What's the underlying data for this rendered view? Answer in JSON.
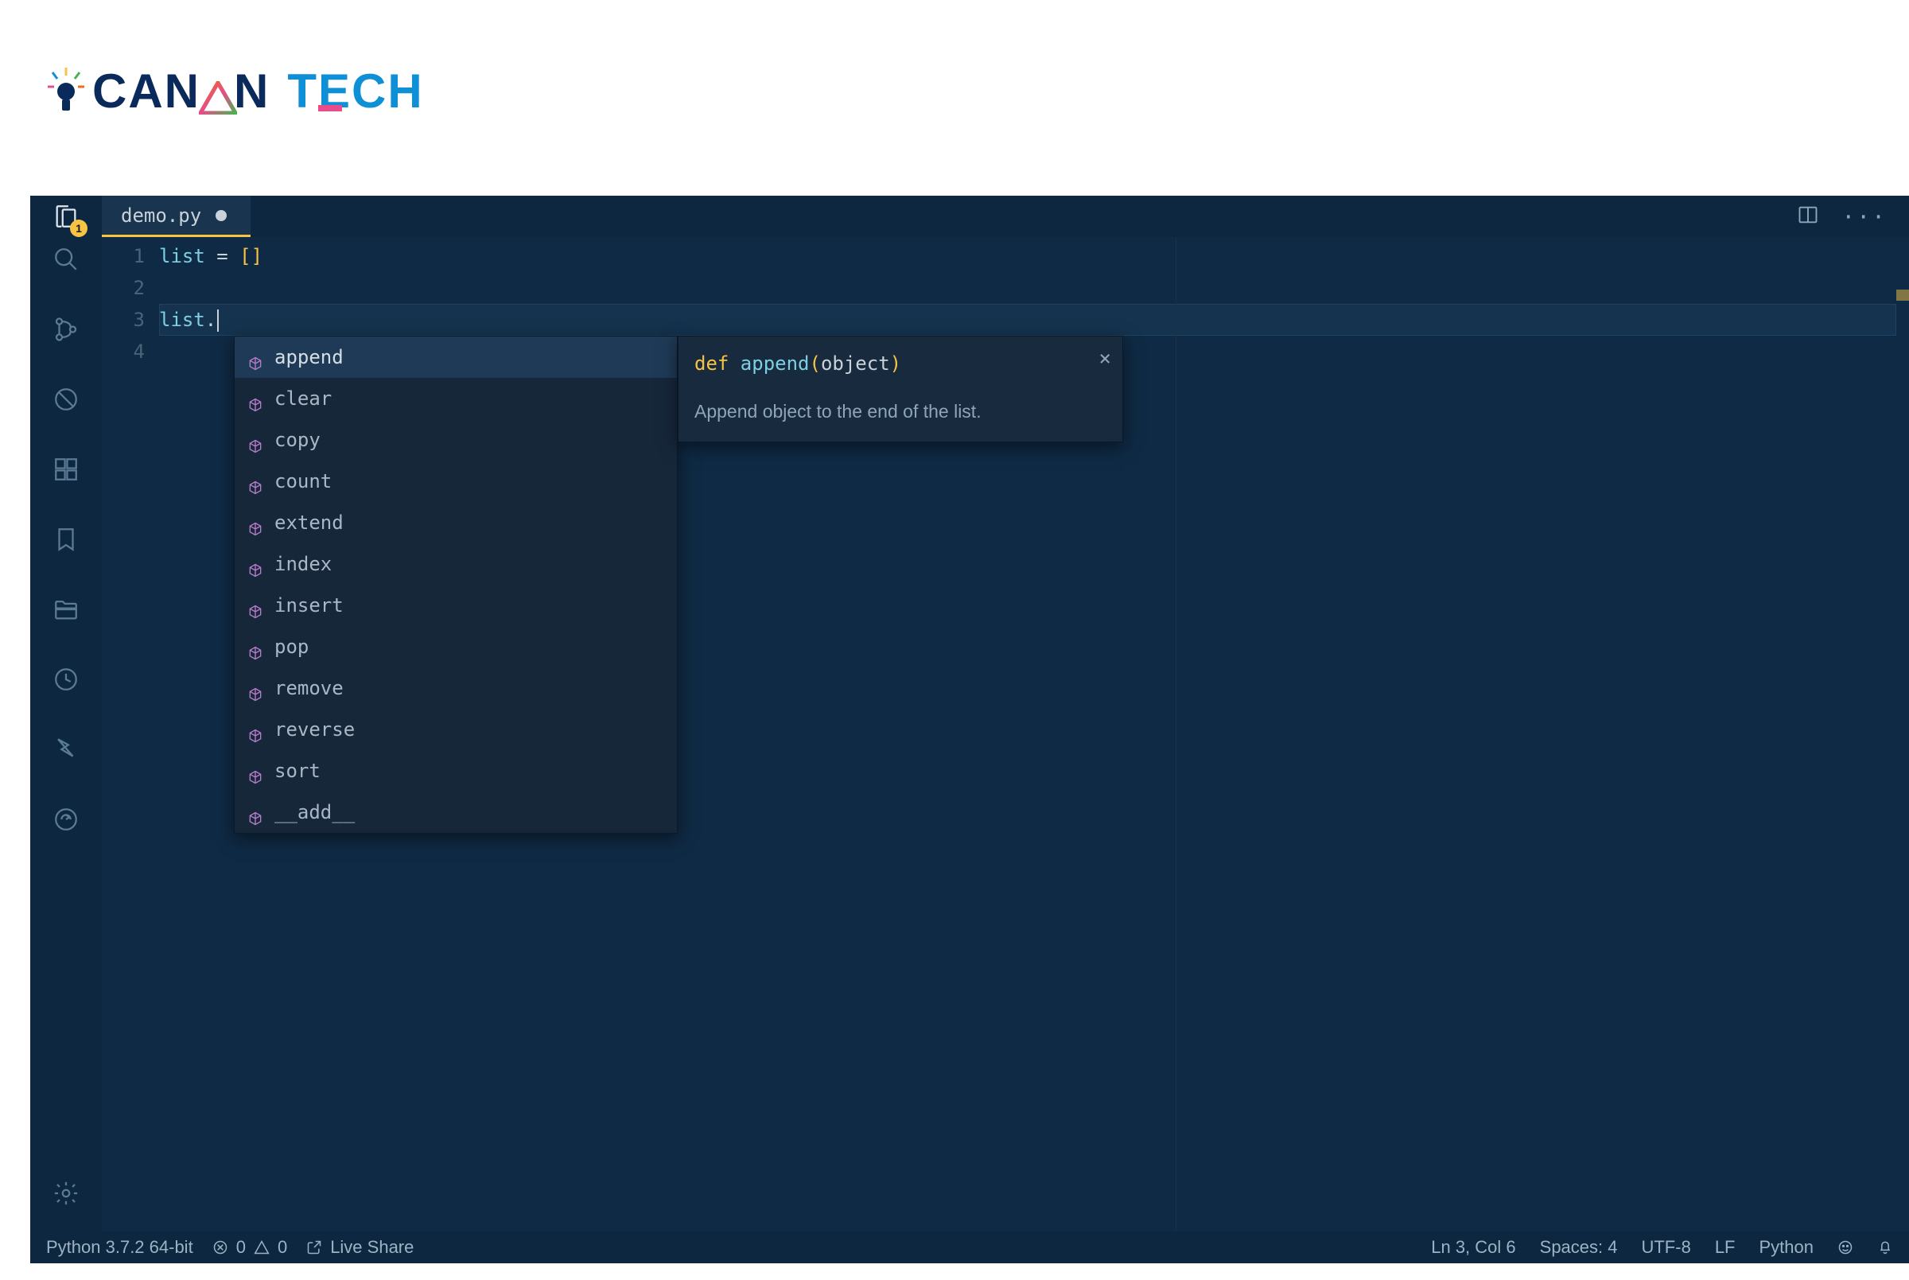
{
  "logo": {
    "i": "i",
    "can": "CAN",
    "tech": "TECH"
  },
  "tab": {
    "name": "demo.py"
  },
  "badge": "1",
  "code": {
    "lines": [
      {
        "n": "1",
        "var": "list",
        "rest": " = ",
        "br_open": "[",
        "br_close": "]"
      },
      {
        "n": "2"
      },
      {
        "n": "3",
        "var": "list",
        "dot": "."
      },
      {
        "n": "4"
      }
    ]
  },
  "ac": {
    "items": [
      {
        "label": "append",
        "sel": true
      },
      {
        "label": "clear"
      },
      {
        "label": "copy"
      },
      {
        "label": "count"
      },
      {
        "label": "extend"
      },
      {
        "label": "index"
      },
      {
        "label": "insert"
      },
      {
        "label": "pop"
      },
      {
        "label": "remove"
      },
      {
        "label": "reverse"
      },
      {
        "label": "sort"
      },
      {
        "label": "__add__"
      }
    ]
  },
  "doc": {
    "def": "def ",
    "name": "append",
    "open": "(",
    "arg": "object",
    "close": ")",
    "desc": "Append object to the end of the list.",
    "x": "×"
  },
  "status": {
    "python": "Python 3.7.2 64-bit",
    "err": "0",
    "warn": "0",
    "live": "Live Share",
    "pos": "Ln 3, Col 6",
    "spaces": "Spaces: 4",
    "enc": "UTF-8",
    "eol": "LF",
    "lang": "Python"
  }
}
